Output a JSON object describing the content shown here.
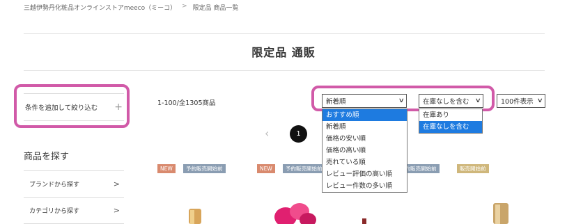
{
  "breadcrumb": {
    "home": "三越伊勢丹化粧品オンラインストアmeeco（ミーコ）",
    "separator": ">",
    "current": "限定品 商品一覧"
  },
  "page": {
    "title": "限定品 通販"
  },
  "sidebar": {
    "filter_label": "条件を追加して絞り込む",
    "filter_icon": "plus-icon",
    "search_heading": "商品を探す",
    "items": [
      {
        "label": "ブランドから探す"
      },
      {
        "label": "カテゴリから探す"
      }
    ]
  },
  "toolbar": {
    "count": "1-100/全1305商品",
    "sort_value": "新着順",
    "stock_value": "在庫なしを含む",
    "per_page_value": "100件表示"
  },
  "sort_options": [
    "おすすめ順",
    "新着順",
    "価格の安い順",
    "価格の高い順",
    "売れている順",
    "レビュー評価の高い順",
    "レビュー件数の多い順"
  ],
  "stock_options": [
    "在庫あり",
    "在庫なしを含む"
  ],
  "annotation": {
    "number": "1"
  },
  "pager": {
    "prev": "‹",
    "partial": "/"
  },
  "tags": [
    {
      "label": "NEW"
    },
    {
      "label": "予約販売開始前"
    },
    {
      "label": "NEW"
    },
    {
      "label": "予約販売開始前"
    },
    {
      "label": "予約販売開始前"
    },
    {
      "label": "販売開始前"
    }
  ],
  "colors": {
    "highlight_ring": "#d15aa8",
    "selected_option": "#1e7be0",
    "tag_new": "#d98a6e",
    "tag_pre": "#8a9db2",
    "tag_sale": "#cfb77b"
  }
}
